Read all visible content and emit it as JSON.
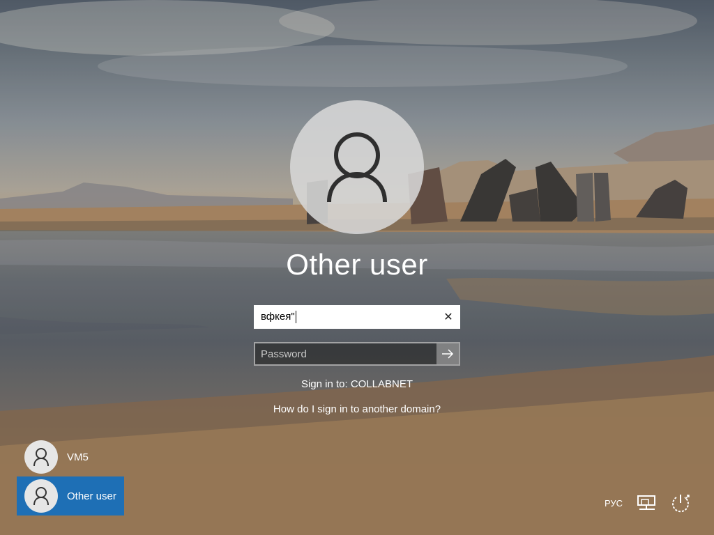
{
  "user": {
    "display_name": "Other user"
  },
  "form": {
    "username_value": "вфкея\"",
    "clear_glyph": "✕",
    "password_placeholder": "Password",
    "submit_icon": "arrow-right-icon"
  },
  "info": {
    "sign_in_to": "Sign in to: COLLABNET",
    "other_domain_link": "How do I sign in to another domain?"
  },
  "user_tiles": [
    {
      "label": "VM5",
      "selected": false
    },
    {
      "label": "Other user",
      "selected": true
    }
  ],
  "tray": {
    "language": "РУС",
    "network_icon": "network-icon",
    "power_icon": "power-icon"
  },
  "colors": {
    "selected_tile": "#1e6fb5",
    "avatar_circle": "#d7d7d7"
  }
}
